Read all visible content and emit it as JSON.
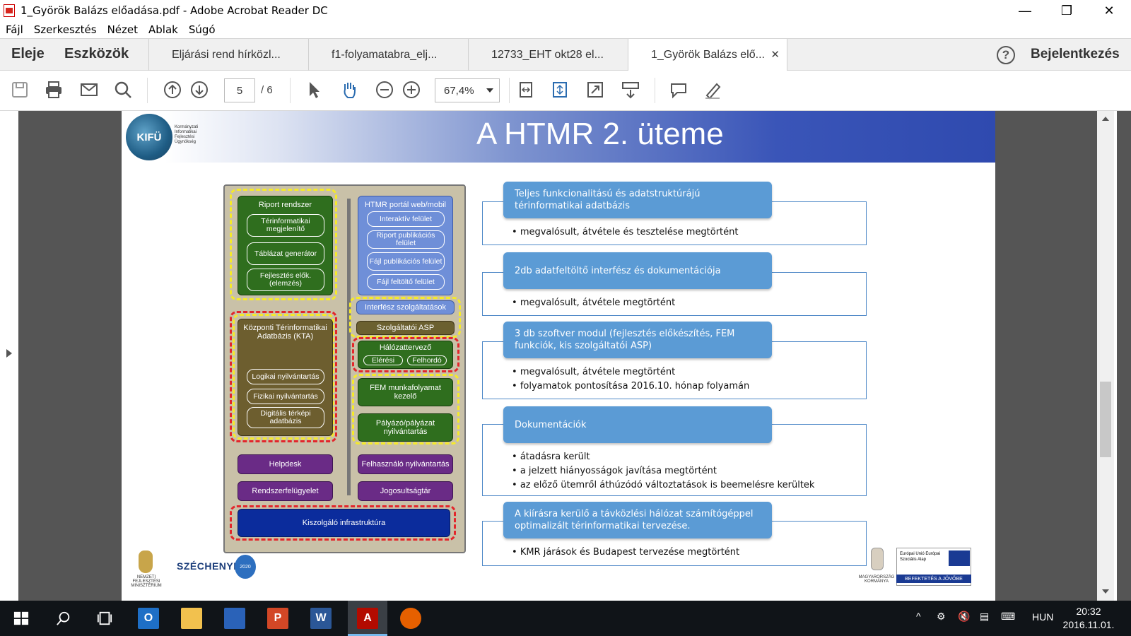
{
  "window": {
    "title": "1_Györök Balázs előadása.pdf - Adobe Acrobat Reader DC",
    "controls": {
      "minimize": "—",
      "maximize": "❐",
      "close": "✕"
    }
  },
  "menu": [
    "Fájl",
    "Szerkesztés",
    "Nézet",
    "Ablak",
    "Súgó"
  ],
  "tabs": {
    "home": "Eleje",
    "tools": "Eszközök",
    "documents": [
      "Eljárási rend hírközl...",
      "f1-folyamatabra_elj...",
      "12733_EHT okt28 el...",
      "1_Györök Balázs elő..."
    ],
    "close_glyph": "✕",
    "help": "?",
    "signin": "Bejelentkezés"
  },
  "toolbar": {
    "page_current": "5",
    "page_total": "/ 6",
    "zoom": "67,4%"
  },
  "slide": {
    "title": "A HTMR 2. üteme",
    "logo_text": "KIFÜ",
    "logo_subtitle": "Kormányzati Informatikai Fejlesztési Ügynökség",
    "diagram": {
      "riport": "Riport rendszer",
      "riport_items": [
        "Térinformatikai megjelenítő",
        "Táblázat generátor",
        "Fejlesztés elők. (elemzés)"
      ],
      "kta": "Központi Térinformatikai Adatbázis (KTA)",
      "kta_items": [
        "Logikai nyilvántartás",
        "Fizikai nyilvántartás",
        "Digitális térképi adatbázis"
      ],
      "portal": "HTMR portál web/mobil",
      "portal_items": [
        "Interaktív felület",
        "Riport publikációs felület",
        "Fájl publikációs felület",
        "Fájl feltöltő felület"
      ],
      "interfesz": "Interfész szolgáltatások",
      "asp": "Szolgáltatói ASP",
      "halozat": "Hálózattervező",
      "halozat_items": [
        "Elérési",
        "Felhordó"
      ],
      "fem": "FEM munkafolyamat kezelő",
      "palyazo": "Pályázó/pályázat nyilvántartás",
      "helpdesk": "Helpdesk",
      "felhasznalo": "Felhasználó nyilvántartás",
      "rendszer": "Rendszerfelügyelet",
      "jogosult": "Jogosultságtár",
      "infra": "Kiszolgáló infrastruktúra"
    },
    "sections": [
      {
        "heading": "Teljes funkcionalitású és adatstruktúrájú térinformatikai adatbázis",
        "bullets": [
          "megvalósult, átvétele és tesztelése megtörtént"
        ]
      },
      {
        "heading": "2db adatfeltöltő interfész és dokumentációja",
        "bullets": [
          "megvalósult, átvétele megtörtént"
        ]
      },
      {
        "heading": "3 db szoftver modul (fejlesztés előkészítés, FEM funkciók, kis szolgáltatói ASP)",
        "bullets": [
          "megvalósult, átvétele megtörtént",
          "folyamatok pontosítása 2016.10. hónap folyamán"
        ]
      },
      {
        "heading": "Dokumentációk",
        "bullets": [
          "átadásra került",
          "a jelzett hiányosságok javítása megtörtént",
          "az előző ütemről áthúzódó változtatások is beemelésre kerültek"
        ]
      },
      {
        "heading": "A kiírásra kerülő a távközlési hálózat számítógéppel optimalizált térinformatikai tervezése.",
        "bullets": [
          "KMR járások és Budapest tervezése megtörtént"
        ]
      }
    ],
    "footer": {
      "ministry": "NEMZETI FEJLESZTÉSI MINISZTÉRIUM",
      "szechenyi": "SZÉCHENYI",
      "szechenyi_year": "2020",
      "government": "MAGYARORSZÁG KORMÁNYA",
      "eu_text": "Európai Unió Európai Szociális Alap",
      "eu_slogan": "BEFEKTETÉS A JÖVŐBE"
    }
  },
  "taskbar": {
    "lang": "HUN",
    "time": "20:32",
    "date": "2016.11.01."
  }
}
